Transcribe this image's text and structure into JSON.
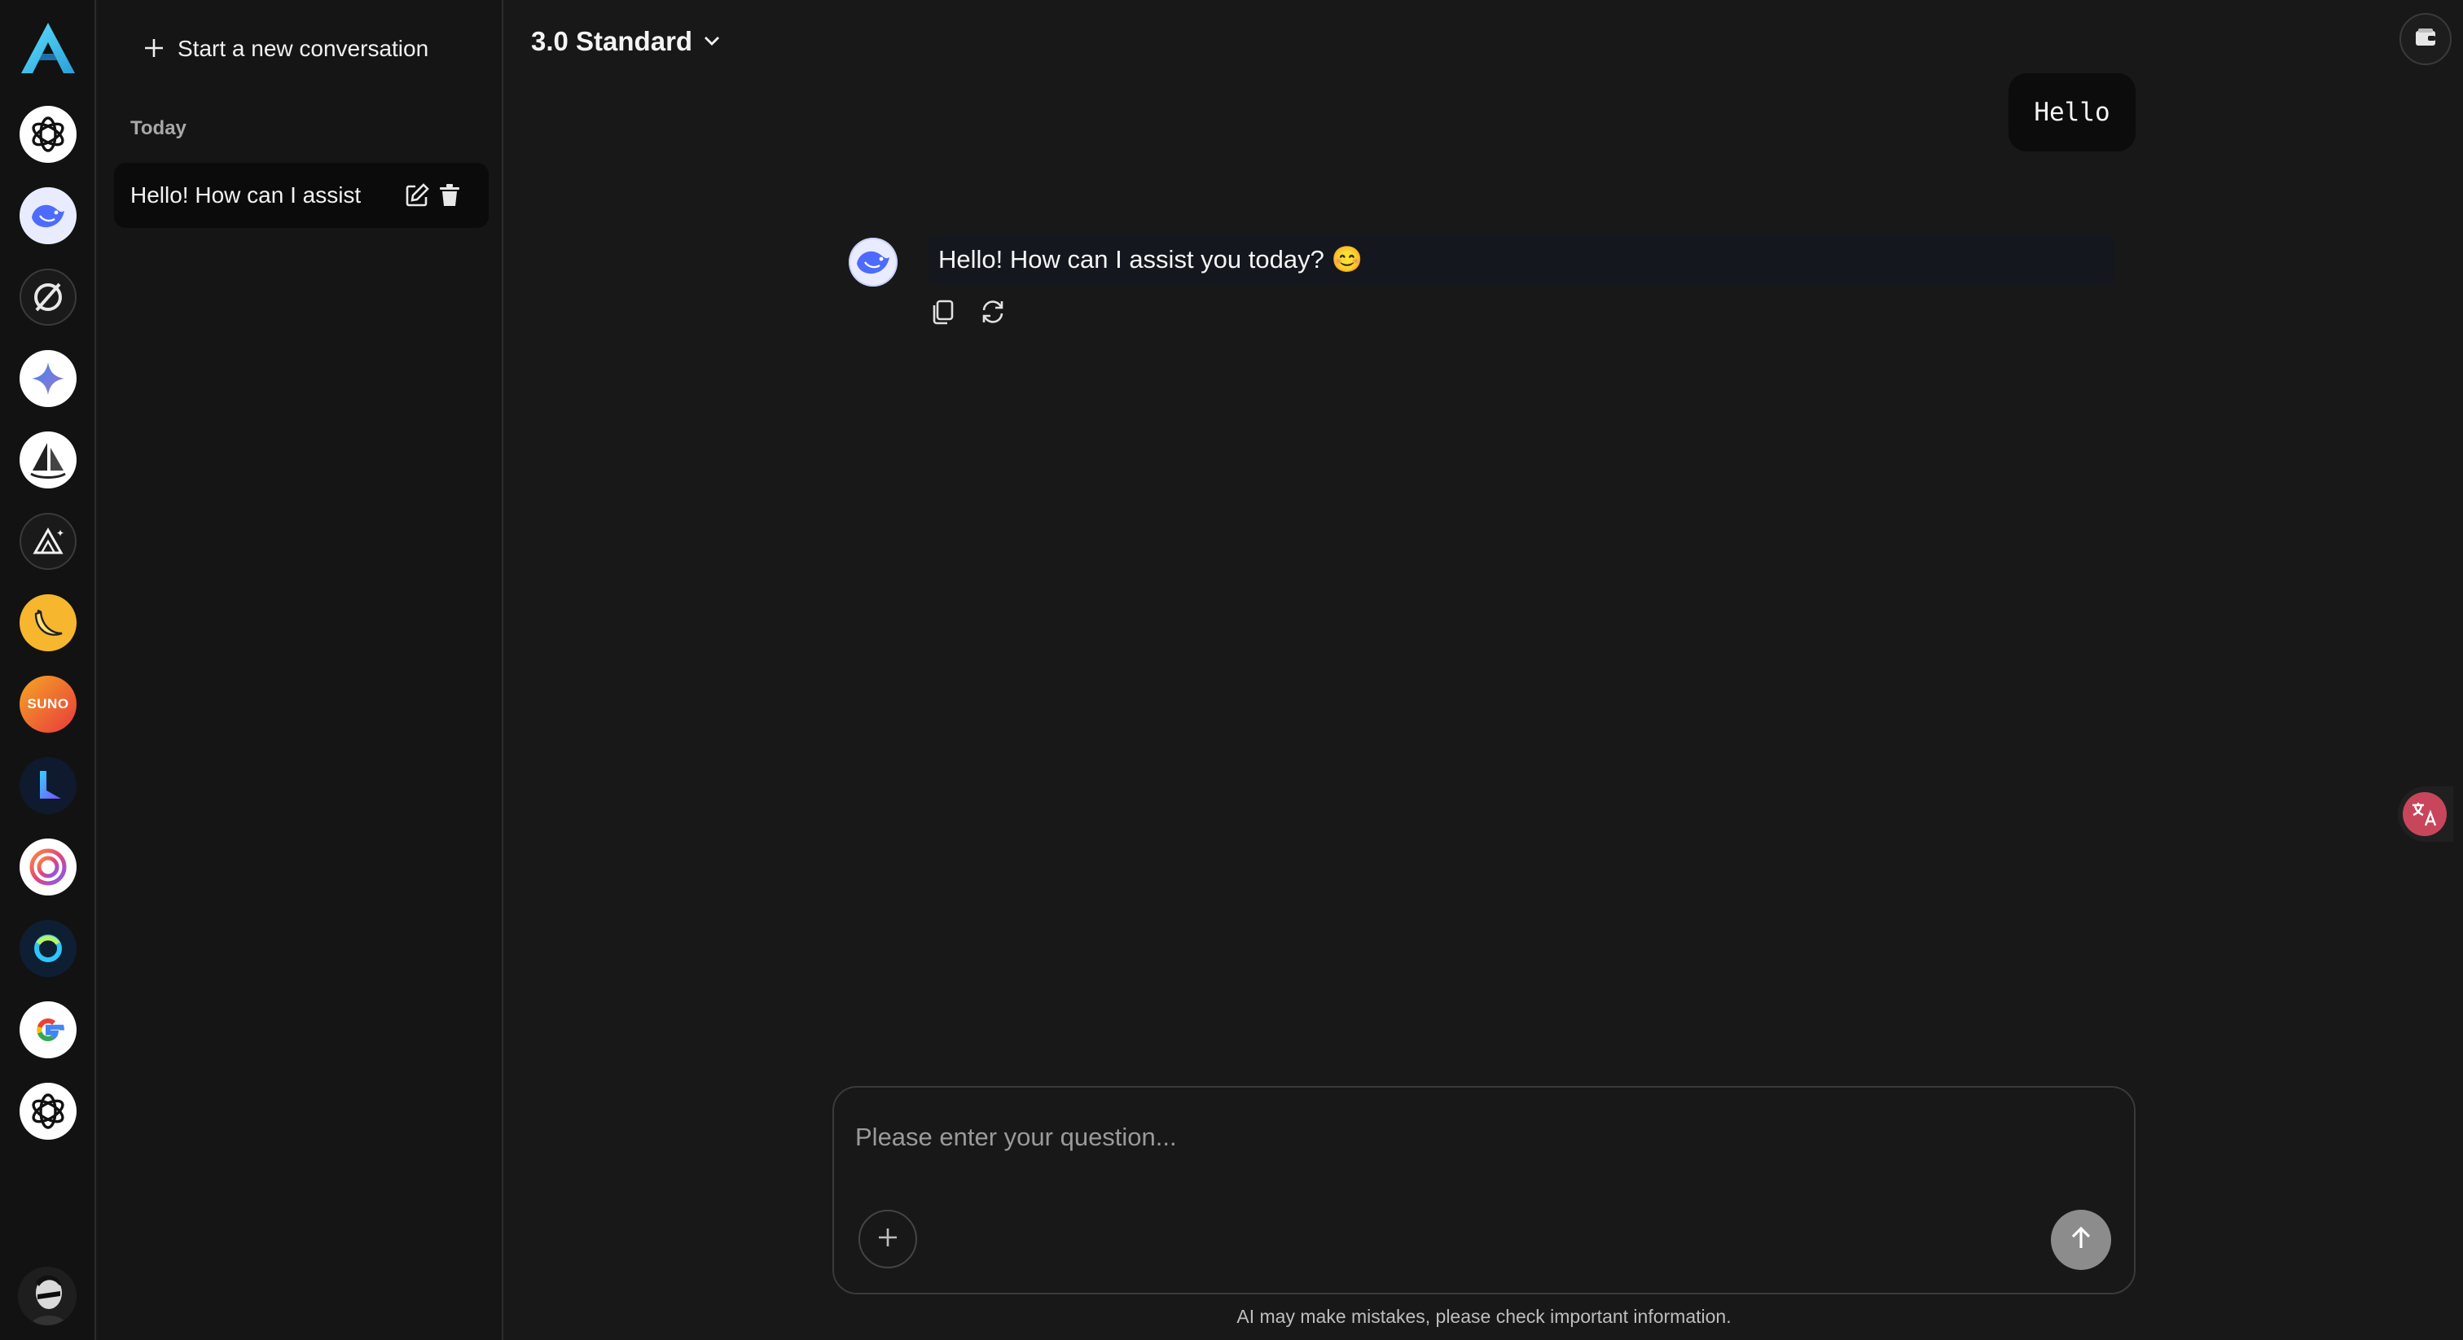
{
  "rail": {
    "apps": [
      {
        "name": "chatgpt-app-icon"
      },
      {
        "name": "deepseek-app-icon"
      },
      {
        "name": "perplexity-app-icon"
      },
      {
        "name": "gemini-app-icon"
      },
      {
        "name": "midjourney-app-icon"
      },
      {
        "name": "stable-diffusion-app-icon"
      },
      {
        "name": "banana-app-icon"
      },
      {
        "name": "suno-app-icon",
        "text": "SUNO"
      },
      {
        "name": "kling-app-icon"
      },
      {
        "name": "spiral-app-icon"
      },
      {
        "name": "ring-app-icon"
      },
      {
        "name": "google-app-icon"
      },
      {
        "name": "openai-app-icon"
      }
    ]
  },
  "sidebar": {
    "new_conversation_label": "Start a new conversation",
    "section_today": "Today",
    "conversations": [
      {
        "title": "Hello! How can I assist"
      }
    ]
  },
  "header": {
    "model_label": "3.0 Standard"
  },
  "chat": {
    "user_message": "Hello",
    "assistant_message": "Hello! How can I assist you today? 😊"
  },
  "composer": {
    "placeholder": "Please enter your question...",
    "value": ""
  },
  "footer": {
    "disclaimer": "AI may make mistakes, please check important information."
  },
  "colors": {
    "background": "#181818",
    "rail_background": "#121212",
    "sidebar_background": "#151515",
    "logo_accent": "#3bc6e8",
    "deepseek_blue": "#4d6bfe",
    "translate_badge": "#c7465b",
    "send_button": "#8c8c8c"
  }
}
